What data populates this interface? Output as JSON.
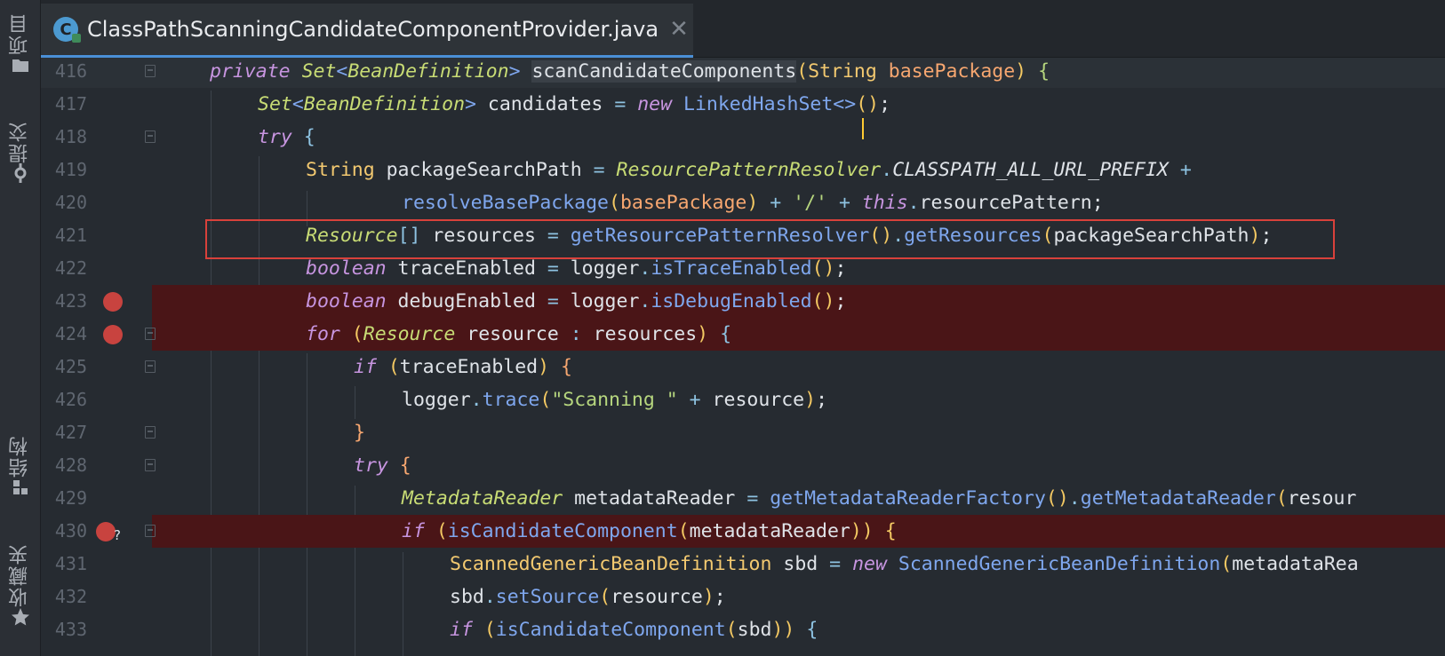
{
  "sidebar": {
    "items": [
      {
        "label": "项目",
        "icon": "folder-icon"
      },
      {
        "label": "提交",
        "icon": "commit-icon"
      },
      {
        "label": "结构",
        "icon": "structure-icon"
      },
      {
        "label": "收藏夹",
        "icon": "star-icon"
      }
    ]
  },
  "tab": {
    "icon_letter": "C",
    "title": "ClassPathScanningCandidateComponentProvider.java",
    "close": "✕"
  },
  "lines": [
    {
      "n": "416",
      "t": "private Set<BeanDefinition> scanCandidateComponents(String basePackage) {"
    },
    {
      "n": "417",
      "t": "Set<BeanDefinition> candidates = new LinkedHashSet<>();"
    },
    {
      "n": "418",
      "t": "try {"
    },
    {
      "n": "419",
      "t": "String packageSearchPath = ResourcePatternResolver.CLASSPATH_ALL_URL_PREFIX +"
    },
    {
      "n": "420",
      "t": "resolveBasePackage(basePackage) + '/' + this.resourcePattern;"
    },
    {
      "n": "421",
      "t": "Resource[] resources = getResourcePatternResolver().getResources(packageSearchPath);"
    },
    {
      "n": "422",
      "t": "boolean traceEnabled = logger.isTraceEnabled();"
    },
    {
      "n": "423",
      "t": "boolean debugEnabled = logger.isDebugEnabled();"
    },
    {
      "n": "424",
      "t": "for (Resource resource : resources) {"
    },
    {
      "n": "425",
      "t": "if (traceEnabled) {"
    },
    {
      "n": "426",
      "t": "logger.trace(\"Scanning \" + resource);"
    },
    {
      "n": "427",
      "t": "}"
    },
    {
      "n": "428",
      "t": "try {"
    },
    {
      "n": "429",
      "t": "MetadataReader metadataReader = getMetadataReaderFactory().getMetadataReader(resour"
    },
    {
      "n": "430",
      "t": "if (isCandidateComponent(metadataReader)) {"
    },
    {
      "n": "431",
      "t": "ScannedGenericBeanDefinition sbd = new ScannedGenericBeanDefinition(metadataRea"
    },
    {
      "n": "432",
      "t": "sbd.setSource(resource);"
    },
    {
      "n": "433",
      "t": "if (isCandidateComponent(sbd)) {"
    }
  ],
  "breakpoints": [
    "423",
    "424",
    "430"
  ],
  "colors": {
    "background": "#262b31",
    "breakpoint_line": "#4a1517",
    "breakpoint": "#c8433f",
    "highlight_box": "#d8413b"
  }
}
